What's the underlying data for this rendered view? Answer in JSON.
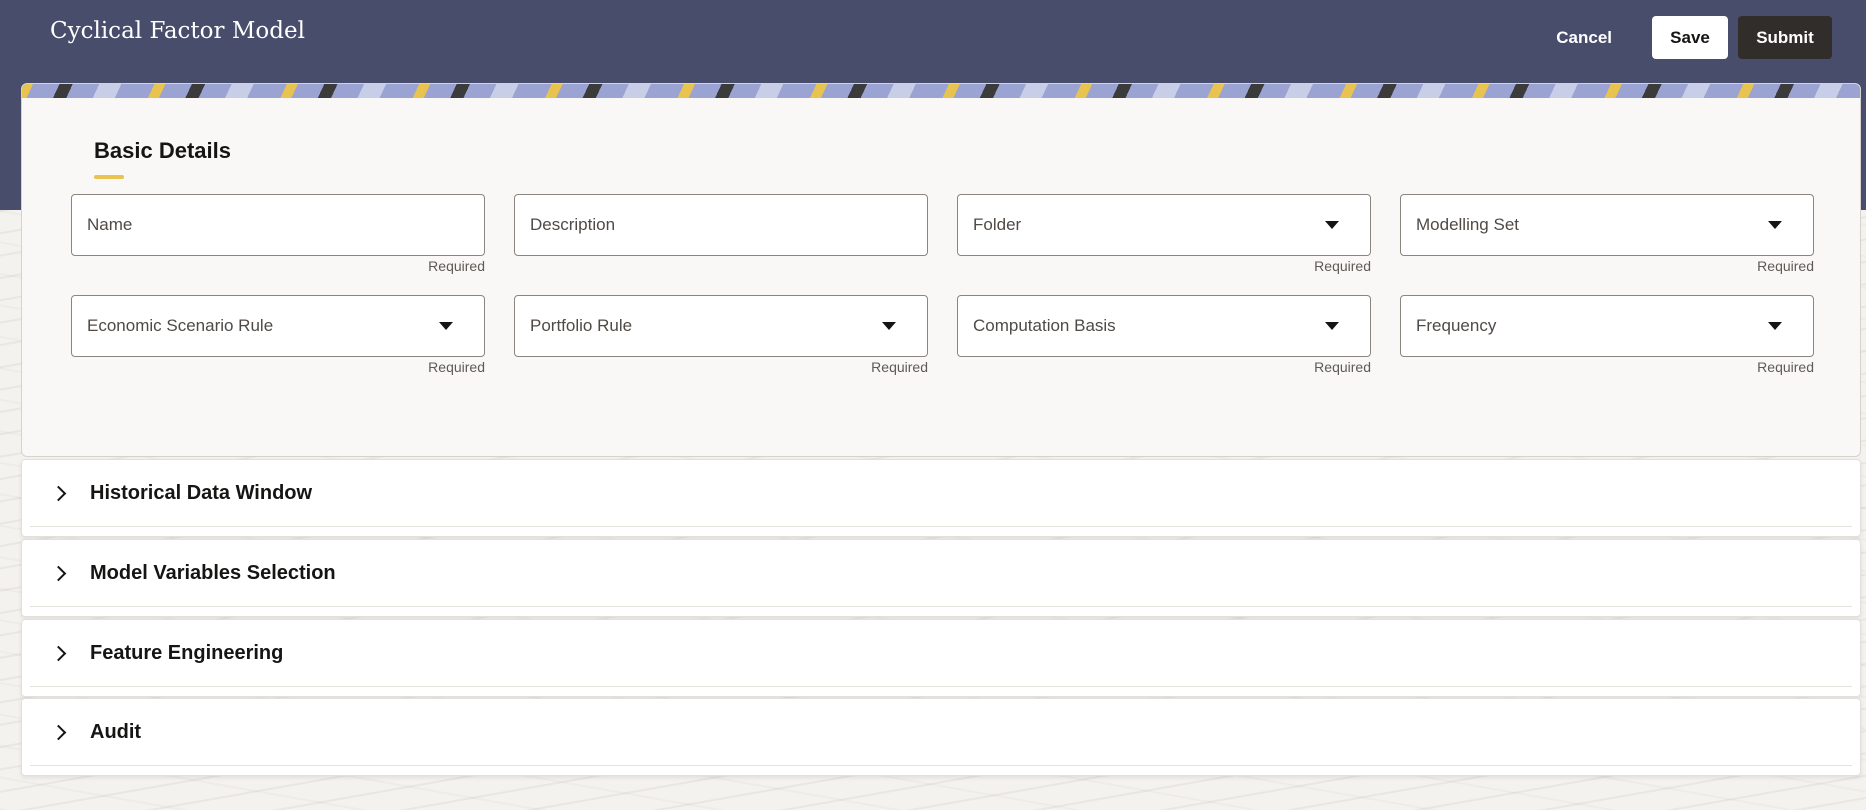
{
  "app": {
    "title": "Cyclical Factor Model"
  },
  "actions": {
    "cancel_label": "Cancel",
    "save_label": "Save",
    "submit_label": "Submit"
  },
  "basic_details": {
    "title": "Basic Details",
    "fields": [
      {
        "label": "Name",
        "type": "text",
        "helper": "Required"
      },
      {
        "label": "Description",
        "type": "text",
        "helper": ""
      },
      {
        "label": "Folder",
        "type": "select",
        "helper": "Required"
      },
      {
        "label": "Modelling Set",
        "type": "select",
        "helper": "Required"
      },
      {
        "label": "Economic Scenario Rule",
        "type": "select",
        "helper": "Required"
      },
      {
        "label": "Portfolio Rule",
        "type": "select",
        "helper": "Required"
      },
      {
        "label": "Computation Basis",
        "type": "select",
        "helper": "Required"
      },
      {
        "label": "Frequency",
        "type": "select",
        "helper": "Required"
      }
    ]
  },
  "sections": [
    {
      "label": "Historical Data Window",
      "icon": "chevron-right-icon"
    },
    {
      "label": "Model Variables Selection",
      "icon": "chevron-right-icon"
    },
    {
      "label": "Feature Engineering",
      "icon": "chevron-right-icon"
    },
    {
      "label": "Audit",
      "icon": "chevron-right-icon"
    }
  ],
  "colors": {
    "header": "#474d6a",
    "accent": "#e9c350",
    "submit": "#312d2a"
  }
}
